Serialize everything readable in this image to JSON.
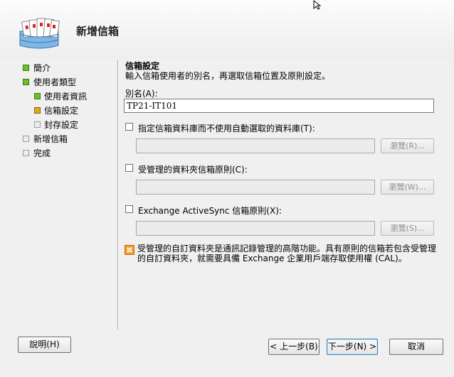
{
  "wizard": {
    "title": "新增信箱"
  },
  "nav": {
    "items": [
      {
        "label": "簡介",
        "state": "green"
      },
      {
        "label": "使用者類型",
        "state": "green"
      },
      {
        "label": "使用者資訊",
        "state": "green"
      },
      {
        "label": "信箱設定",
        "state": "yellow"
      },
      {
        "label": "封存設定",
        "state": "gray"
      },
      {
        "label": "新增信箱",
        "state": "gray"
      },
      {
        "label": "完成",
        "state": "gray"
      }
    ]
  },
  "main": {
    "section_title": "信箱設定",
    "section_desc": "輸入信箱使用者的別名，再選取信箱位置及原則設定。",
    "alias_label": "別名(A):",
    "alias_value": "TP21-IT101",
    "option_database": {
      "label": "指定信箱資料庫而不使用自動選取的資料庫(T):",
      "checked": false,
      "browse_label": "瀏覽(R)..."
    },
    "option_managed_folder": {
      "label": "受管理的資料夾信箱原則(C):",
      "checked": false,
      "browse_label": "瀏覽(W)..."
    },
    "option_activesync": {
      "label": "Exchange ActiveSync 信箱原則(X):",
      "checked": false,
      "browse_label": "瀏覽(S)..."
    },
    "info_text": "受管理的自訂資料夾是通訊記錄管理的高階功能。具有原則的信箱若包含受管理的自訂資料夾，就需要具備 Exchange 企業用戶端存取使用權 (CAL)。"
  },
  "footer": {
    "help_label": "說明(H)",
    "back_label": "< 上一步(B)",
    "next_label": "下一步(N) >",
    "cancel_label": "取消"
  },
  "colors": {
    "step_done": "#6bbf2a",
    "step_current": "#e2a81a",
    "step_pending": "#eeeeee",
    "info_icon": "#f79c2b"
  }
}
